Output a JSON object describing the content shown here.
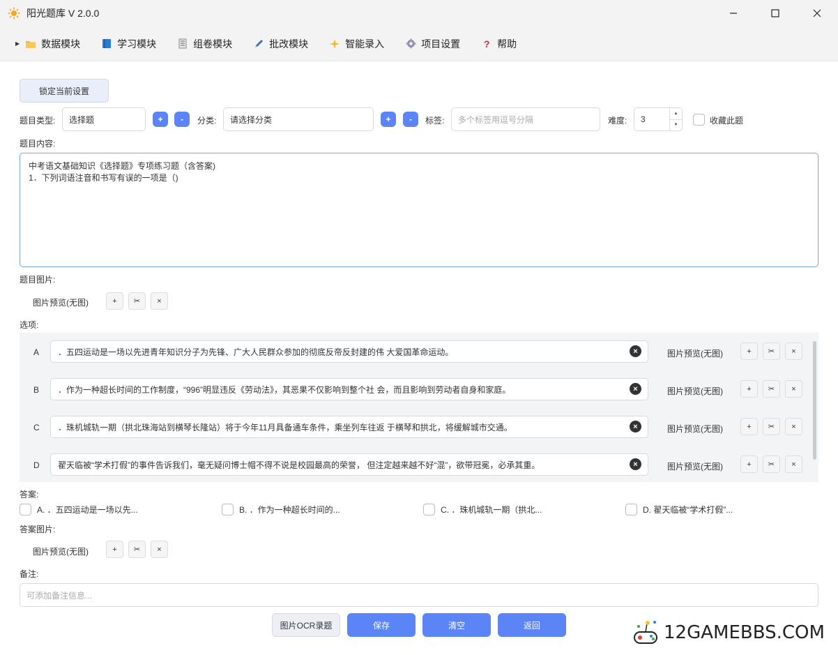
{
  "window": {
    "title": "阳光题库 V 2.0.0",
    "minimize_glyph": "—",
    "maximize_glyph": "☐",
    "close_glyph": "✕"
  },
  "menu": {
    "items": [
      {
        "label": "数据模块",
        "icon": "folder-icon"
      },
      {
        "label": "学习模块",
        "icon": "book-icon"
      },
      {
        "label": "组卷模块",
        "icon": "list-icon"
      },
      {
        "label": "批改模块",
        "icon": "pen-icon"
      },
      {
        "label": "智能录入",
        "icon": "sparkle-icon"
      },
      {
        "label": "项目设置",
        "icon": "gear-icon"
      },
      {
        "label": "帮助",
        "icon": "question-icon"
      }
    ]
  },
  "form": {
    "lock_label": "锁定当前设置",
    "type_label": "题目类型:",
    "type_value": "选择题",
    "category_label": "分类:",
    "category_placeholder": "请选择分类",
    "tag_label": "标签:",
    "tag_placeholder": "多个标签用逗号分隔",
    "difficulty_label": "难度:",
    "difficulty_value": "3",
    "favorite_label": "收藏此题",
    "plus": "+",
    "minus": "-",
    "content_label": "题目内容:",
    "content_line1": "中考语文基础知识《选择题》专项练习题（含答案)",
    "content_line2": "1．下列词语注音和书写有误的一项是（)",
    "question_image_label": "题目图片:",
    "image_preview": "图片预览(无图)",
    "options_label": "选项:",
    "answer_label": "答案:",
    "answer_image_label": "答案图片:",
    "remark_label": "备注:",
    "remark_placeholder": "可添加备注信息..."
  },
  "image_buttons": {
    "add": "+",
    "crop": "✂",
    "remove": "×"
  },
  "options": [
    {
      "letter": "A",
      "text": "．五四运动是一场以先进青年知识分子为先锋、广大人民群众参加的彻底反帝反封建的伟 大爱国革命运动。",
      "preview": "图片预览(无图)"
    },
    {
      "letter": "B",
      "text": "．作为一种超长时间的工作制度，“996”明显违反《劳动法》，其恶果不仅影响到整个社 会，而且影响到劳动者自身和家庭。",
      "preview": "图片预览(无图)"
    },
    {
      "letter": "C",
      "text": "．珠机城轨一期（拱北珠海站到横琴长隆站）将于今年11月具备通车条件，乘坐列车往返 于横琴和拱北，将缓解城市交通。",
      "preview": "图片预览(无图)"
    },
    {
      "letter": "D",
      "text": "翟天临被“学术打假”的事件告诉我们，毫无疑问博士帽不得不说是校园最高的荣誉， 但注定越来越不好“混”，欲带冠冕，必承其重。",
      "preview": "图片预览(无图)"
    }
  ],
  "answers": [
    {
      "label": "A. ．五四运动是一场以先..."
    },
    {
      "label": "B. ．作为一种超长时间的..."
    },
    {
      "label": "C. ．珠机城轨一期（拱北..."
    },
    {
      "label": "D. 翟天临被“学术打假”..."
    }
  ],
  "buttons": {
    "ocr": "图片OCR录题",
    "save": "保存",
    "clear": "清空",
    "back": "返回"
  },
  "watermark": "12GAMEBBS.COM",
  "colors": {
    "accent": "#5b84f6",
    "focus_border": "#7aa6e8"
  }
}
